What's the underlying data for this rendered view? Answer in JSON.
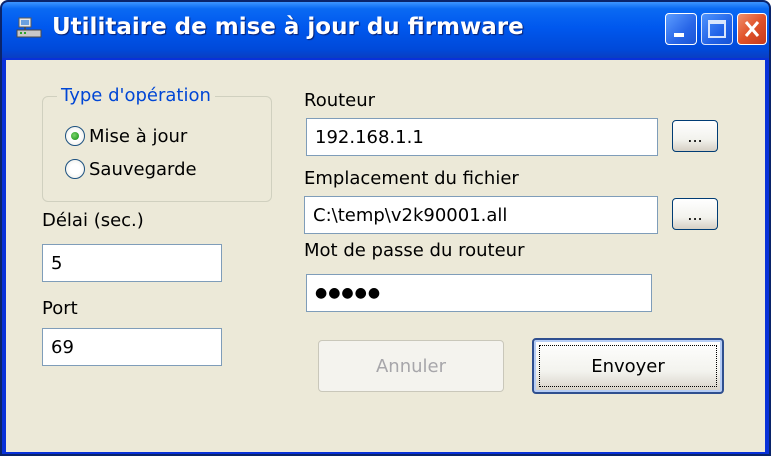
{
  "window": {
    "title": "Utilitaire de mise à jour du firmware"
  },
  "operation_group": {
    "legend": "Type d'opération",
    "options": [
      {
        "label": "Mise à jour",
        "selected": true
      },
      {
        "label": "Sauvegarde",
        "selected": false
      }
    ]
  },
  "delay": {
    "label": "Délai (sec.)",
    "value": "5"
  },
  "port": {
    "label": "Port",
    "value": "69"
  },
  "router": {
    "label": "Routeur",
    "value": "192.168.1.1",
    "browse_label": "..."
  },
  "file_location": {
    "label": "Emplacement du fichier",
    "value": "C:\\temp\\v2k90001.all",
    "browse_label": "..."
  },
  "router_password": {
    "label": "Mot de passe du routeur",
    "masked_value": "●●●●●"
  },
  "buttons": {
    "cancel_label": "Annuler",
    "send_label": "Envoyer"
  },
  "colors": {
    "titlebar": "#0058ee",
    "window_bg": "#ece9d8",
    "group_legend": "#0046d5",
    "disabled_text": "#a7a6aa",
    "close_button": "#e0522a"
  }
}
